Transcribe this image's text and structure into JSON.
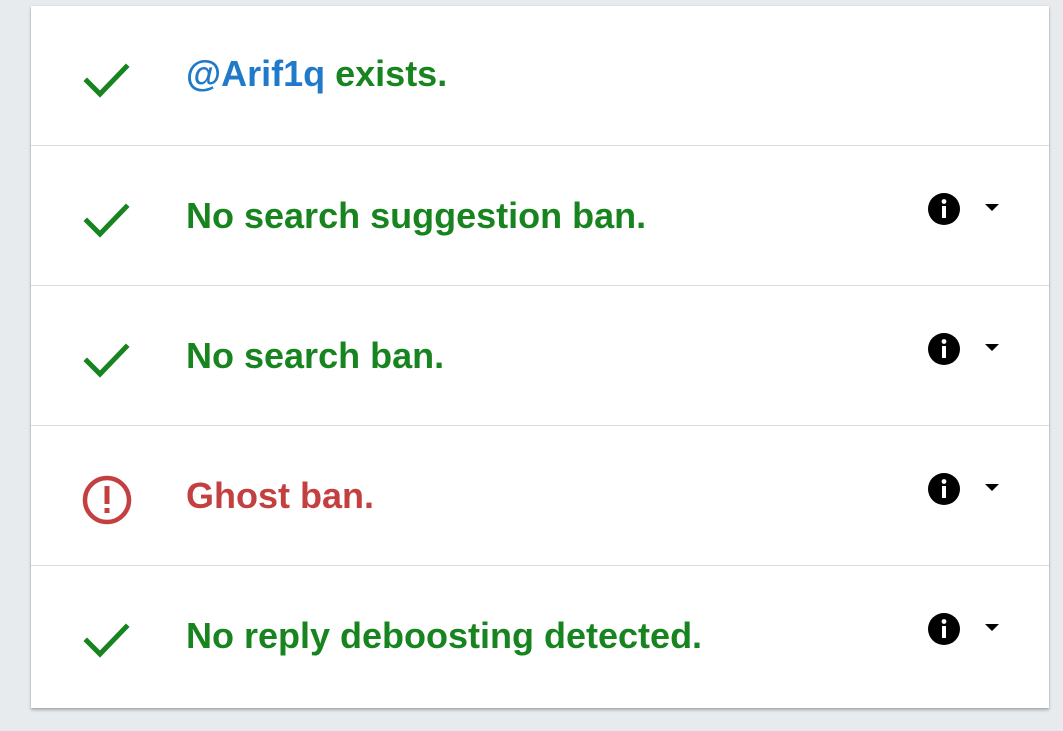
{
  "colors": {
    "success": "#17841f",
    "error": "#c44040",
    "link": "#1f7ac9",
    "icon": "#000000"
  },
  "checks": [
    {
      "status": "ok",
      "icon": "check-icon",
      "handle": "@Arif1q",
      "label": " exists.",
      "has_details": false
    },
    {
      "status": "ok",
      "icon": "check-icon",
      "label": "No search suggestion ban.",
      "has_details": true
    },
    {
      "status": "ok",
      "icon": "check-icon",
      "label": "No search ban.",
      "has_details": true
    },
    {
      "status": "ban",
      "icon": "alert-circle-icon",
      "label": "Ghost ban.",
      "has_details": true
    },
    {
      "status": "ok",
      "icon": "check-icon",
      "label": "No reply deboosting detected.",
      "has_details": true
    }
  ]
}
